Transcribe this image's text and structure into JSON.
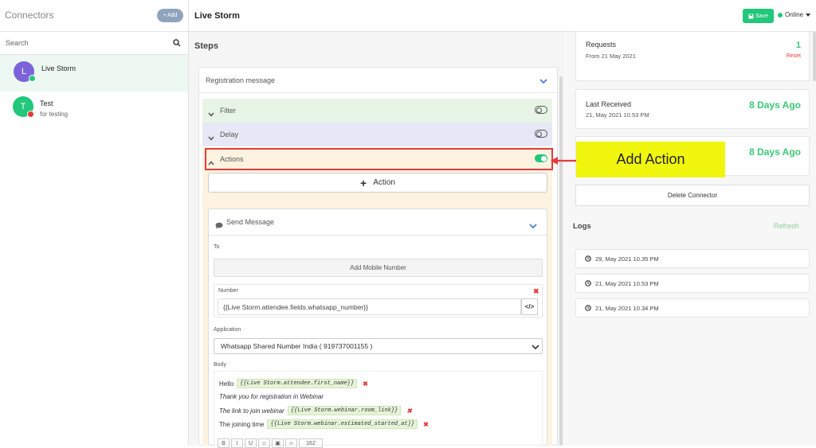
{
  "sidebar": {
    "title": "Connectors",
    "add_label": "Add",
    "search_placeholder": "Search",
    "connectors": [
      {
        "initial": "L",
        "name": "Live Storm",
        "description": "",
        "avatar_color": "#7c63d9",
        "status_color": "#21c77a",
        "selected": true
      },
      {
        "initial": "T",
        "name": "Test",
        "description": "for testing",
        "avatar_color": "#21c77a",
        "status_color": "#e53b3b",
        "selected": false
      }
    ]
  },
  "header": {
    "title": "Live Storm",
    "save_label": "Save",
    "status_label": "Online"
  },
  "steps": {
    "title": "Steps",
    "trigger_label": "Registration message",
    "filter_label": "Filter",
    "delay_label": "Delay",
    "actions_label": "Actions",
    "add_action_label": "Action",
    "send_message": {
      "title": "Send Message",
      "to_label": "To",
      "add_mobile_label": "Add Mobile Number",
      "number_label": "Number",
      "number_value": "{{Live Storm.attendee.fields.whatsapp_number}}",
      "code_icon": "</>",
      "application_label": "Application",
      "application_value": "Whatsapp Shared Number India ( 919737001155 )",
      "body_label": "Body",
      "body": {
        "line1_text": "Hello",
        "line1_tag": "{{Live Storm.attendee.first_name}}",
        "line2_text": "Thank you for registration in  Webinar",
        "line3_text": "The link to join webinar",
        "line3_tag": "{{Live Storm.webinar.room_link}}",
        "line4_text": "The joining time",
        "line4_tag": "{{Live Storm.webinar.estimated_started_at}}",
        "remove_mark": "✖"
      },
      "toolbar": {
        "bold": "B",
        "italic": "I",
        "underline": "U",
        "count": "162"
      }
    }
  },
  "stats": {
    "requests_label": "Requests",
    "requests_sub": "From 21 May 2021",
    "requests_value": "1",
    "reset_label": "Reset",
    "last_received_label": "Last Received",
    "last_received_sub": "21, May 2021 10.53 PM",
    "last_received_value": "8 Days Ago",
    "third_value": "8 Days Ago",
    "delete_label": "Delete Connector"
  },
  "logs": {
    "title": "Logs",
    "refresh_label": "Refresh",
    "entries": [
      "29, May 2021 10.35 PM",
      "21, May 2021 10.53 PM",
      "21, May 2021 10.34 PM"
    ]
  },
  "annotation": {
    "label": "Add Action"
  },
  "colors": {
    "accent_green": "#21c77a",
    "error_red": "#e53b3b",
    "highlight_yellow": "#f1f60e"
  }
}
